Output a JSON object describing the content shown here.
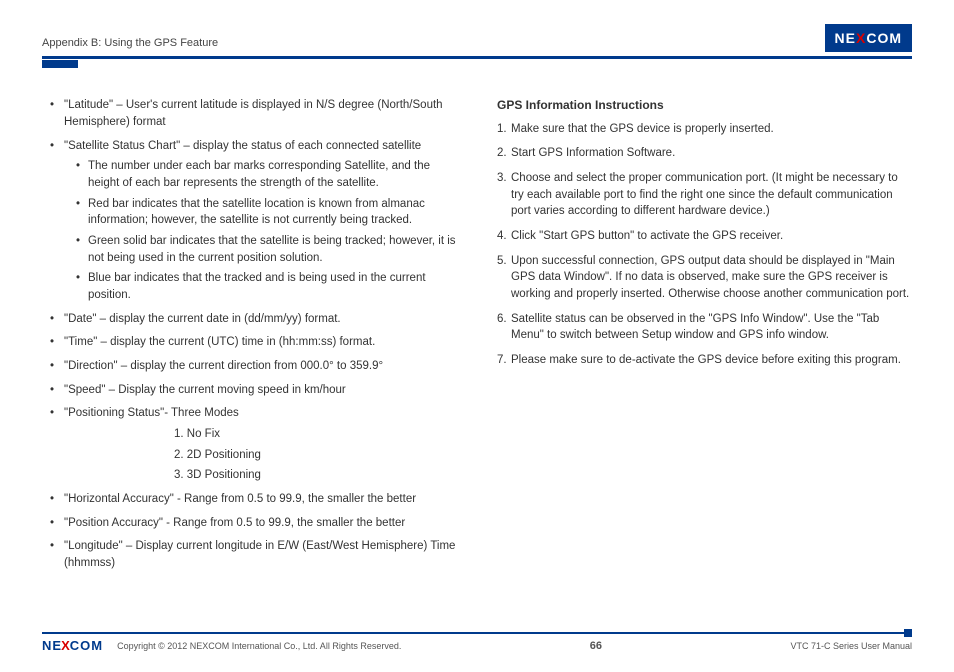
{
  "header": {
    "title": "Appendix B: Using the GPS Feature",
    "brand_left": "NE",
    "brand_x": "X",
    "brand_right": "COM"
  },
  "left": {
    "items": [
      {
        "text": "\"Latitude\" – User's current latitude is displayed in N/S degree (North/South Hemisphere) format"
      },
      {
        "text": "\"Satellite Status Chart\" – display the status of each connected satellite",
        "sub": [
          "The number under each bar marks corresponding Satellite, and the height of each bar represents the strength of the satellite.",
          "Red bar indicates that the satellite location is known from almanac information; however, the satellite is not currently being tracked.",
          "Green solid bar indicates that the satellite is being tracked; however, it is not being used in the current position solution.",
          "Blue bar indicates that the tracked and is being used in the current position."
        ]
      },
      {
        "text": "\"Date\" – display the current date in (dd/mm/yy) format."
      },
      {
        "text": "\"Time\" – display the current (UTC) time in (hh:mm:ss) format."
      },
      {
        "text": "\"Direction\" – display the current direction from 000.0° to 359.9°"
      },
      {
        "text": "\"Speed\" – Display the current moving speed in km/hour"
      },
      {
        "text": "\"Positioning Status\"- Three Modes",
        "modes": [
          "1. No Fix",
          "2. 2D Positioning",
          "3. 3D Positioning"
        ]
      },
      {
        "text": "\"Horizontal Accuracy\" - Range from 0.5 to 99.9, the smaller the better"
      },
      {
        "text": "\"Position Accuracy\" - Range from 0.5 to 99.9, the smaller the better"
      },
      {
        "text": "\"Longitude\" – Display current longitude in E/W (East/West Hemisphere) Time (hhmmss)"
      }
    ]
  },
  "right": {
    "title": "GPS Information Instructions",
    "steps": [
      "Make sure that the GPS device is properly inserted.",
      "Start GPS Information Software.",
      "Choose and select the proper communication port. (It might be necessary to try each available port to find the right one since the default communication port varies according to different hardware device.)",
      "Click \"Start GPS button\" to activate the GPS receiver.",
      "Upon successful connection, GPS output data should be displayed in \"Main GPS data Window\". If no data is observed, make sure the GPS receiver is working and properly inserted. Otherwise choose another communication port.",
      "Satellite status can be observed in the \"GPS Info Window\". Use the \"Tab Menu\" to switch between Setup window and GPS info window.",
      "Please make sure to de-activate the GPS device before exiting this program."
    ]
  },
  "footer": {
    "brand_left": "NE",
    "brand_x": "X",
    "brand_right": "COM",
    "copyright": "Copyright © 2012 NEXCOM International Co., Ltd. All Rights Reserved.",
    "page": "66",
    "manual": "VTC 71-C Series User Manual"
  }
}
